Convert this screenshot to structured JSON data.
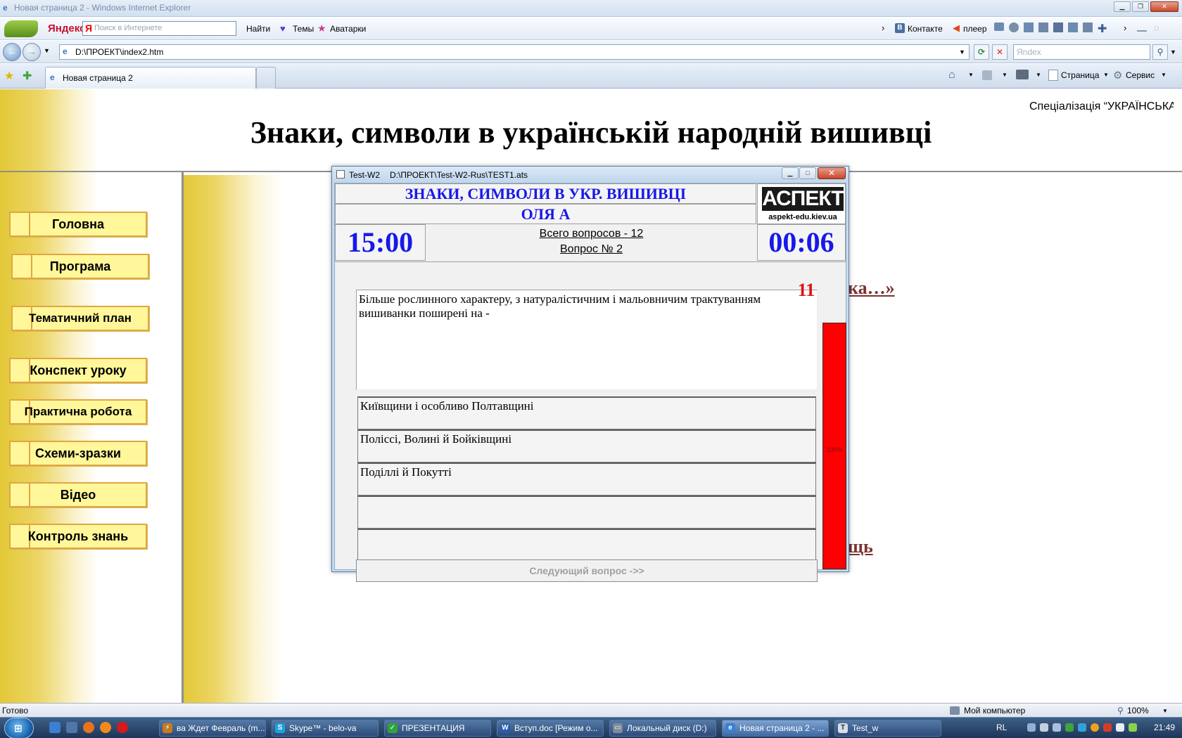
{
  "window": {
    "title": "Новая страница 2 - Windows Internet Explorer"
  },
  "yandex_bar": {
    "logo": "Яндекс",
    "search_placeholder": "Поиск в Интернете",
    "find_label": "Найти",
    "themes_label": "Темы",
    "avatars_label": "Аватарки",
    "vkontakte_label": "Контакте",
    "player_label": "плеер"
  },
  "nav": {
    "address": "D:\\ПРОЕКТ\\index2.htm",
    "search_placeholder": "Яndex"
  },
  "tabs": {
    "active_label": "Новая страница 2"
  },
  "command_bar": {
    "page_label": "Страница",
    "tools_label": "Сервис"
  },
  "page": {
    "title": "Знаки, символи в українській народній вишивці",
    "specialization": "Спеціалізація “УКРАЇНСЬКА",
    "menu": [
      {
        "label": "Головна"
      },
      {
        "label": "Програма"
      },
      {
        "label": "Тематичний план"
      },
      {
        "label": "Конспект уроку"
      },
      {
        "label": "Практична робота"
      },
      {
        "label": "Схеми-зразки"
      },
      {
        "label": "Відео"
      },
      {
        "label": "Контроль знань"
      }
    ],
    "behind_link_1": "ка…»",
    "behind_link_2": "щь"
  },
  "dialog": {
    "app_name": "Test-W2",
    "file_path": "D:\\ПРОЕКТ\\Test-W2-Rus\\TEST1.ats",
    "test_title": "ЗНАКИ, СИМВОЛИ В УКР. ВИШИВЦІ",
    "student": "ОЛЯ А",
    "logo_text": "АСПЕКТ",
    "logo_url": "aspekt-edu.kiev.ua",
    "time_total": "15:00",
    "time_elapsed": "00:06",
    "total_questions": "Всего вопросов - 12",
    "question_number": "Вопрос № 2",
    "question_text": "Більше рослинного характеру, з натуралістичним і мальовничим трактуванням вишиванки поширені на -",
    "answers": [
      {
        "text": "Київщини і особливо Полтавщині"
      },
      {
        "text": "Поліссі, Волині й Бойківщині"
      },
      {
        "text": "Поділлі й Покутті"
      },
      {
        "text": ""
      },
      {
        "text": ""
      }
    ],
    "next_button": "Следующий вопрос ->>",
    "countdown": "11",
    "progress_label": "100%",
    "progress_fraction": 1.0
  },
  "status": {
    "left": "Готово",
    "zone": "Мой компьютер",
    "zoom": "100%"
  },
  "taskbar": {
    "items": [
      {
        "label": "ва Ждет Февраль (m..."
      },
      {
        "label": "Skype™ - belo-va"
      },
      {
        "label": "ПРЕЗЕНТАЦИЯ"
      },
      {
        "label": "Вступ.doc [Режим о..."
      },
      {
        "label": "Локальный диск (D:)"
      },
      {
        "label": "Новая страница 2 - ..."
      },
      {
        "label": "Test_w"
      }
    ],
    "lang": "RL",
    "clock": "21:49"
  },
  "colors": {
    "accent_blue": "#1818e8",
    "countdown_red": "#e01212",
    "menu_fill": "#fff79a",
    "menu_border": "#e0a642",
    "link_brown": "#7a3334"
  }
}
